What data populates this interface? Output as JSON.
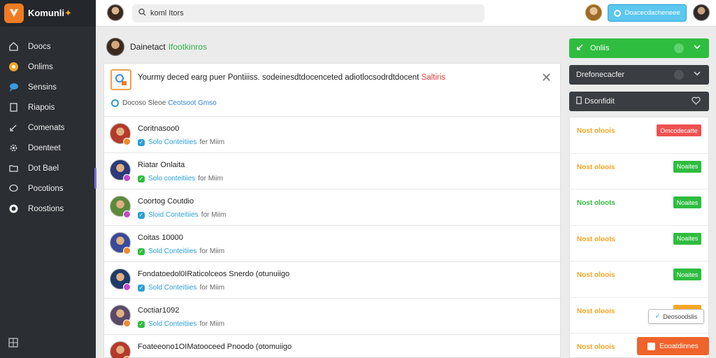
{
  "app": {
    "name_main": "Komunli",
    "name_accent": "✦"
  },
  "sidebar": {
    "items": [
      {
        "label": "Doocs",
        "icon": "home-icon"
      },
      {
        "label": "Onlims",
        "icon": "orange-circle-icon"
      },
      {
        "label": "Sensins",
        "icon": "blue-bubble-icon"
      },
      {
        "label": "Riapois",
        "icon": "document-icon"
      },
      {
        "label": "Comenats",
        "icon": "link-icon"
      },
      {
        "label": "Doenteet",
        "icon": "gear-icon"
      },
      {
        "label": "Dot Bael",
        "icon": "folder-icon"
      },
      {
        "label": "Pocotions",
        "icon": "chat-icon"
      },
      {
        "label": "Roostions",
        "icon": "target-icon"
      }
    ]
  },
  "topbar": {
    "search_value": "koml Itors",
    "pill_label": "Doacecdacheneee"
  },
  "channel": {
    "title": "Dainetact",
    "status": "Ifootkinros"
  },
  "notice": {
    "text": "Yourmy deced earg puer Pontiiiss. sodeinesdtdocenceted adiotlocsodrdtdocent",
    "highlight": "Saltiris",
    "sub_plain": "Docoso Sleoe",
    "sub_link": "Ceotsoot Gmso"
  },
  "feed": [
    {
      "title": "Coritnasoo0",
      "lead": "Solo Conteitiies",
      "rest": "fer Miim",
      "avatar": "#b53a2a",
      "badge": "#f08a2b",
      "check": "#2aa0d8"
    },
    {
      "title": "Riatar Onlaita",
      "lead": "Solo conteitiies",
      "rest": "for Miim",
      "avatar": "#2a3a7a",
      "badge": "#c04ac8",
      "check": "#2ebd3f"
    },
    {
      "title": "Coortog Coutdio",
      "lead": "Sloid Conteitiies",
      "rest": "for Miim",
      "avatar": "#5c8a3a",
      "badge": "#c04ac8",
      "check": "#2aa0d8"
    },
    {
      "title": "Coitas 10000",
      "lead": "Sold Conteitiies",
      "rest": "for Miim",
      "avatar": "#3a4a9a",
      "badge": "#f08a2b",
      "check": "#2ebd3f"
    },
    {
      "title": "Fondatoedol0IRaticolceos Snerdo (otunuiigo",
      "lead": "Sold Conteitiies",
      "rest": "for Miim",
      "avatar": "#1e3a6a",
      "badge": "#c04ac8",
      "check": "#2aa0d8"
    },
    {
      "title": "Coctiar1092",
      "lead": "Sold Conteitiies",
      "rest": "for Miim",
      "avatar": "#5a4a6a",
      "badge": "#f08a2b",
      "check": "#2ebd3f"
    },
    {
      "title": "Foateeono1OIMatooceed Pnoodo (otomuiigo",
      "lead": "",
      "rest": "",
      "avatar": "#b53a2a",
      "badge": "#f08a2b",
      "check": "#2aa0d8"
    }
  ],
  "right": {
    "online_label": "Onliis",
    "dark1_label": "Drefonecacfer",
    "dark2_label": "Dsonfidit",
    "stats": [
      {
        "label": "Nost oloois",
        "label_color": "#f5a623",
        "btn": "Omcodecatte",
        "btn_type": "red"
      },
      {
        "label": "Nost oloois",
        "label_color": "#f5a623",
        "btn": "Noaites",
        "btn_type": "green"
      },
      {
        "label": "Nost oloots",
        "label_color": "#2ebd3f",
        "btn": "Noaites",
        "btn_type": "green"
      },
      {
        "label": "Nost oloots",
        "label_color": "#f5a623",
        "btn": "Noaites",
        "btn_type": "green"
      },
      {
        "label": "Nost oloois",
        "label_color": "#f5a623",
        "btn": "Noaites",
        "btn_type": "green"
      },
      {
        "label": "Nost oloois",
        "label_color": "#f5a623",
        "btn": "",
        "btn_type": "orange"
      },
      {
        "label": "Nost oloois",
        "label_color": "#f5a623",
        "btn": "",
        "btn_type": "none"
      }
    ],
    "floating_label": "Deosoodslis",
    "bottom_button": "Eooatdinnes"
  }
}
